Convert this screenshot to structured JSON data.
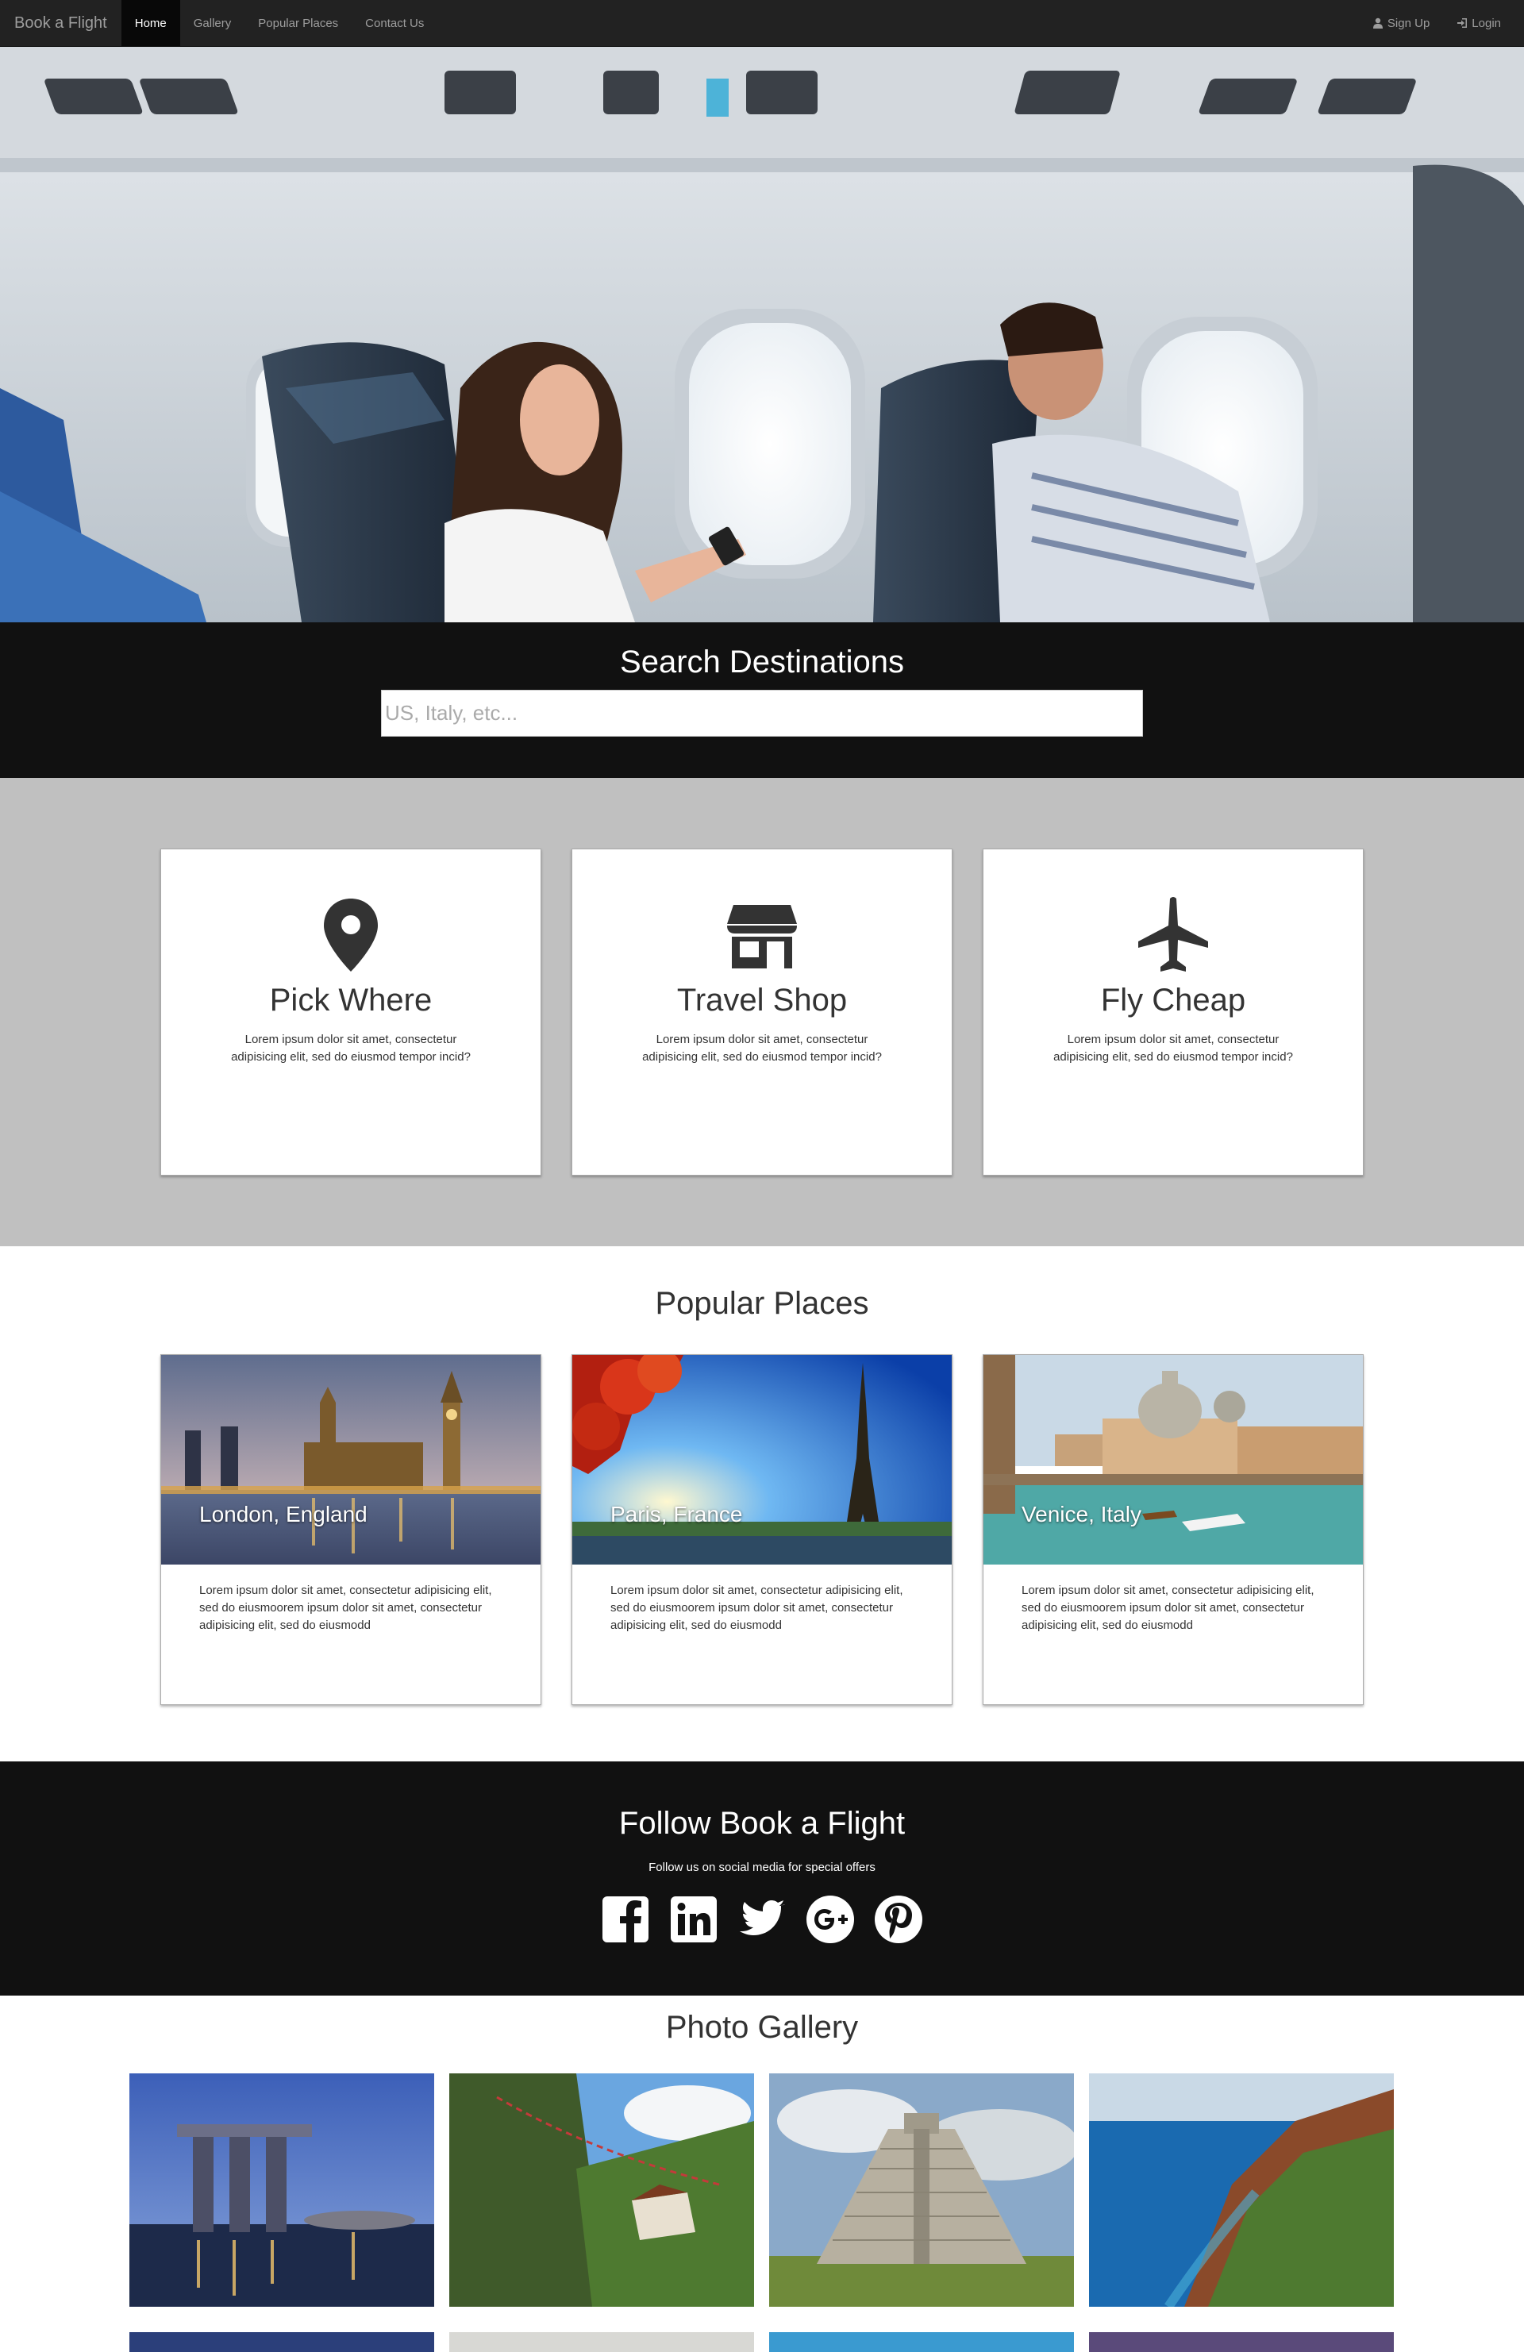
{
  "nav": {
    "brand": "Book a Flight",
    "items": [
      {
        "label": "Home"
      },
      {
        "label": "Gallery"
      },
      {
        "label": "Popular Places"
      },
      {
        "label": "Contact Us"
      }
    ],
    "signup_label": "Sign Up",
    "login_label": "Login",
    "signup_icon": "user-icon",
    "login_icon": "login-icon"
  },
  "search": {
    "title": "Search Destinations",
    "placeholder": "US, Italy, etc..."
  },
  "features": [
    {
      "icon": "map-marker-icon",
      "title": "Pick Where",
      "text": "Lorem ipsum dolor sit amet, consectetur adipisicing elit, sed do eiusmod tempor incid?"
    },
    {
      "icon": "shop-icon",
      "title": "Travel Shop",
      "text": "Lorem ipsum dolor sit amet, consectetur adipisicing elit, sed do eiusmod tempor incid?"
    },
    {
      "icon": "airplane-icon",
      "title": "Fly Cheap",
      "text": "Lorem ipsum dolor sit amet, consectetur adipisicing elit, sed do eiusmod tempor incid?"
    }
  ],
  "popular": {
    "heading": "Popular Places",
    "places": [
      {
        "name": "London, England",
        "text": "Lorem ipsum dolor sit amet, consectetur adipisicing elit, sed do eiusmoorem ipsum dolor sit amet, consectetur adipisicing elit, sed do eiusmodd"
      },
      {
        "name": "Paris, France",
        "text": "Lorem ipsum dolor sit amet, consectetur adipisicing elit, sed do eiusmoorem ipsum dolor sit amet, consectetur adipisicing elit, sed do eiusmodd"
      },
      {
        "name": "Venice, Italy",
        "text": "Lorem ipsum dolor sit amet, consectetur adipisicing elit, sed do eiusmoorem ipsum dolor sit amet, consectetur adipisicing elit, sed do eiusmodd"
      }
    ]
  },
  "follow": {
    "title": "Follow Book a Flight",
    "subtitle": "Follow us on social media for special offers",
    "icons": [
      "facebook-icon",
      "linkedin-icon",
      "twitter-icon",
      "google-plus-icon",
      "pinterest-icon"
    ]
  },
  "gallery": {
    "heading": "Photo Gallery"
  },
  "colors": {
    "navbar": "#222222",
    "dark_band": "#111111",
    "features_bg": "#c0c0c0",
    "icon": "#333333"
  }
}
